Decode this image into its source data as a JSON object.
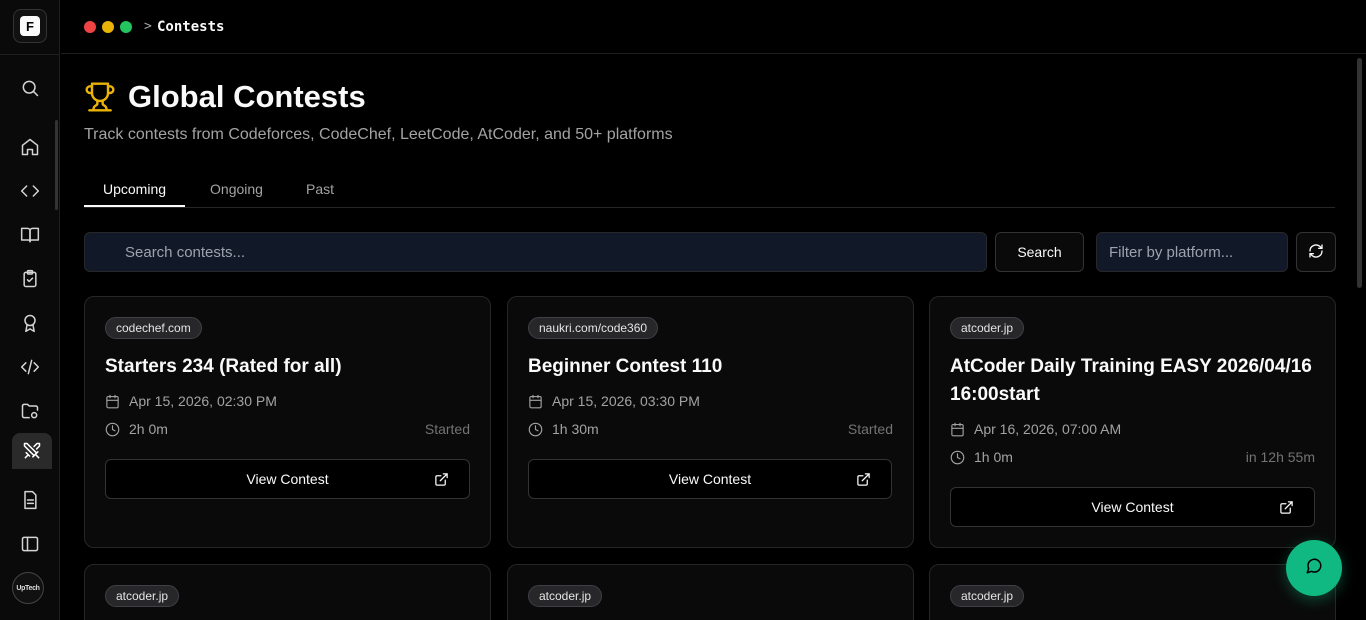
{
  "app": {
    "logo_letter": "F",
    "avatar_text": "UpTech"
  },
  "topbar": {
    "separator": ">",
    "breadcrumb": "Contests",
    "window_dots": [
      "#ef4444",
      "#eab308",
      "#22c55e"
    ]
  },
  "sidebar": {
    "icons": [
      "search-icon",
      "home-icon",
      "code-brackets-icon",
      "book-icon",
      "clipboard-check-icon",
      "award-icon",
      "code-slash-icon",
      "folder-cog-icon",
      "swords-icon",
      "file-text-icon",
      "panel-left-icon"
    ],
    "active": "swords-icon"
  },
  "header": {
    "icon": "trophy-icon",
    "title": "Global Contests",
    "subtitle": "Track contests from Codeforces, CodeChef, LeetCode, AtCoder, and 50+ platforms"
  },
  "tabs": [
    {
      "label": "Upcoming",
      "active": true
    },
    {
      "label": "Ongoing",
      "active": false
    },
    {
      "label": "Past",
      "active": false
    }
  ],
  "search": {
    "placeholder": "Search contests...",
    "value": "",
    "button_label": "Search",
    "filter_placeholder": "Filter by platform..."
  },
  "contests": [
    {
      "platform": "codechef.com",
      "title": "Starters 234 (Rated for all)",
      "date": "Apr 15, 2026, 02:30 PM",
      "duration": "2h 0m",
      "status": "Started",
      "button_label": "View Contest"
    },
    {
      "platform": "naukri.com/code360",
      "title": "Beginner Contest 110",
      "date": "Apr 15, 2026, 03:30 PM",
      "duration": "1h 30m",
      "status": "Started",
      "button_label": "View Contest"
    },
    {
      "platform": "atcoder.jp",
      "title": "AtCoder Daily Training EASY 2026/04/16 16:00start",
      "date": "Apr 16, 2026, 07:00 AM",
      "duration": "1h 0m",
      "status": "in 12h 55m",
      "button_label": "View Contest"
    },
    {
      "platform": "atcoder.jp"
    },
    {
      "platform": "atcoder.jp"
    },
    {
      "platform": "atcoder.jp"
    }
  ],
  "colors": {
    "accent_green": "#10b981",
    "trophy_yellow": "#eab308",
    "input_bg": "#111827"
  },
  "fab": {
    "icon": "message-circle-icon"
  }
}
